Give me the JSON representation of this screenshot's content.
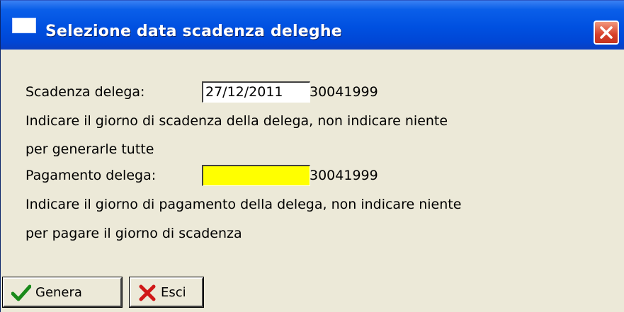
{
  "window": {
    "title": "Selezione data scadenza deleghe"
  },
  "icons": {
    "app": "window-icon",
    "close": "close-icon",
    "genera": "checkmark-icon",
    "esci": "x-icon"
  },
  "colors": {
    "titlebar": "#0050e0",
    "close_button": "#d8402a",
    "pagamento_field": "#ffff00",
    "checkmark": "#1a8a1a",
    "x_mark": "#d01818"
  },
  "form": {
    "scadenza": {
      "label": "Scadenza delega:",
      "value": "27/12/2011",
      "side_text": "30041999",
      "help_line1": "Indicare il giorno di scadenza della delega, non indicare niente",
      "help_line2": "per generarle tutte"
    },
    "pagamento": {
      "label": "Pagamento delega:",
      "value": "",
      "side_text": "30041999",
      "help_line1": "Indicare il giorno di pagamento della delega, non indicare niente",
      "help_line2": "per pagare il giorno di scadenza"
    }
  },
  "buttons": {
    "genera": "Genera",
    "esci": "Esci"
  }
}
